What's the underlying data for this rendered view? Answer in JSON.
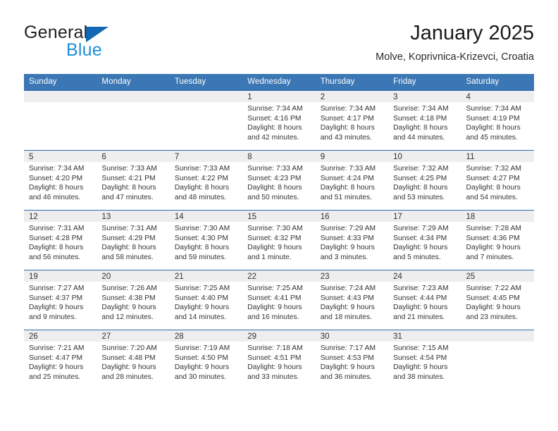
{
  "brand": {
    "name_part1": "General",
    "name_part2": "Blue",
    "triangle_color": "#1268b3",
    "blue_color": "#1d8fd6"
  },
  "header": {
    "title": "January 2025",
    "subtitle": "Molve, Koprivnica-Krizevci, Croatia"
  },
  "theme": {
    "header_bg": "#3b77b5",
    "row_divider": "#2e6cab",
    "daynum_strip_bg": "#eeeeee",
    "text": "#333333"
  },
  "weekdays": [
    "Sunday",
    "Monday",
    "Tuesday",
    "Wednesday",
    "Thursday",
    "Friday",
    "Saturday"
  ],
  "labels": {
    "sunrise_prefix": "Sunrise:",
    "sunset_prefix": "Sunset:",
    "daylight_prefix": "Daylight:"
  },
  "weeks": [
    [
      {
        "day": "",
        "sunrise": "",
        "sunset": "",
        "daylight_line1": "",
        "daylight_line2": ""
      },
      {
        "day": "",
        "sunrise": "",
        "sunset": "",
        "daylight_line1": "",
        "daylight_line2": ""
      },
      {
        "day": "",
        "sunrise": "",
        "sunset": "",
        "daylight_line1": "",
        "daylight_line2": ""
      },
      {
        "day": "1",
        "sunrise": "Sunrise: 7:34 AM",
        "sunset": "Sunset: 4:16 PM",
        "daylight_line1": "Daylight: 8 hours",
        "daylight_line2": "and 42 minutes."
      },
      {
        "day": "2",
        "sunrise": "Sunrise: 7:34 AM",
        "sunset": "Sunset: 4:17 PM",
        "daylight_line1": "Daylight: 8 hours",
        "daylight_line2": "and 43 minutes."
      },
      {
        "day": "3",
        "sunrise": "Sunrise: 7:34 AM",
        "sunset": "Sunset: 4:18 PM",
        "daylight_line1": "Daylight: 8 hours",
        "daylight_line2": "and 44 minutes."
      },
      {
        "day": "4",
        "sunrise": "Sunrise: 7:34 AM",
        "sunset": "Sunset: 4:19 PM",
        "daylight_line1": "Daylight: 8 hours",
        "daylight_line2": "and 45 minutes."
      }
    ],
    [
      {
        "day": "5",
        "sunrise": "Sunrise: 7:34 AM",
        "sunset": "Sunset: 4:20 PM",
        "daylight_line1": "Daylight: 8 hours",
        "daylight_line2": "and 46 minutes."
      },
      {
        "day": "6",
        "sunrise": "Sunrise: 7:33 AM",
        "sunset": "Sunset: 4:21 PM",
        "daylight_line1": "Daylight: 8 hours",
        "daylight_line2": "and 47 minutes."
      },
      {
        "day": "7",
        "sunrise": "Sunrise: 7:33 AM",
        "sunset": "Sunset: 4:22 PM",
        "daylight_line1": "Daylight: 8 hours",
        "daylight_line2": "and 48 minutes."
      },
      {
        "day": "8",
        "sunrise": "Sunrise: 7:33 AM",
        "sunset": "Sunset: 4:23 PM",
        "daylight_line1": "Daylight: 8 hours",
        "daylight_line2": "and 50 minutes."
      },
      {
        "day": "9",
        "sunrise": "Sunrise: 7:33 AM",
        "sunset": "Sunset: 4:24 PM",
        "daylight_line1": "Daylight: 8 hours",
        "daylight_line2": "and 51 minutes."
      },
      {
        "day": "10",
        "sunrise": "Sunrise: 7:32 AM",
        "sunset": "Sunset: 4:25 PM",
        "daylight_line1": "Daylight: 8 hours",
        "daylight_line2": "and 53 minutes."
      },
      {
        "day": "11",
        "sunrise": "Sunrise: 7:32 AM",
        "sunset": "Sunset: 4:27 PM",
        "daylight_line1": "Daylight: 8 hours",
        "daylight_line2": "and 54 minutes."
      }
    ],
    [
      {
        "day": "12",
        "sunrise": "Sunrise: 7:31 AM",
        "sunset": "Sunset: 4:28 PM",
        "daylight_line1": "Daylight: 8 hours",
        "daylight_line2": "and 56 minutes."
      },
      {
        "day": "13",
        "sunrise": "Sunrise: 7:31 AM",
        "sunset": "Sunset: 4:29 PM",
        "daylight_line1": "Daylight: 8 hours",
        "daylight_line2": "and 58 minutes."
      },
      {
        "day": "14",
        "sunrise": "Sunrise: 7:30 AM",
        "sunset": "Sunset: 4:30 PM",
        "daylight_line1": "Daylight: 8 hours",
        "daylight_line2": "and 59 minutes."
      },
      {
        "day": "15",
        "sunrise": "Sunrise: 7:30 AM",
        "sunset": "Sunset: 4:32 PM",
        "daylight_line1": "Daylight: 9 hours",
        "daylight_line2": "and 1 minute."
      },
      {
        "day": "16",
        "sunrise": "Sunrise: 7:29 AM",
        "sunset": "Sunset: 4:33 PM",
        "daylight_line1": "Daylight: 9 hours",
        "daylight_line2": "and 3 minutes."
      },
      {
        "day": "17",
        "sunrise": "Sunrise: 7:29 AM",
        "sunset": "Sunset: 4:34 PM",
        "daylight_line1": "Daylight: 9 hours",
        "daylight_line2": "and 5 minutes."
      },
      {
        "day": "18",
        "sunrise": "Sunrise: 7:28 AM",
        "sunset": "Sunset: 4:36 PM",
        "daylight_line1": "Daylight: 9 hours",
        "daylight_line2": "and 7 minutes."
      }
    ],
    [
      {
        "day": "19",
        "sunrise": "Sunrise: 7:27 AM",
        "sunset": "Sunset: 4:37 PM",
        "daylight_line1": "Daylight: 9 hours",
        "daylight_line2": "and 9 minutes."
      },
      {
        "day": "20",
        "sunrise": "Sunrise: 7:26 AM",
        "sunset": "Sunset: 4:38 PM",
        "daylight_line1": "Daylight: 9 hours",
        "daylight_line2": "and 12 minutes."
      },
      {
        "day": "21",
        "sunrise": "Sunrise: 7:25 AM",
        "sunset": "Sunset: 4:40 PM",
        "daylight_line1": "Daylight: 9 hours",
        "daylight_line2": "and 14 minutes."
      },
      {
        "day": "22",
        "sunrise": "Sunrise: 7:25 AM",
        "sunset": "Sunset: 4:41 PM",
        "daylight_line1": "Daylight: 9 hours",
        "daylight_line2": "and 16 minutes."
      },
      {
        "day": "23",
        "sunrise": "Sunrise: 7:24 AM",
        "sunset": "Sunset: 4:43 PM",
        "daylight_line1": "Daylight: 9 hours",
        "daylight_line2": "and 18 minutes."
      },
      {
        "day": "24",
        "sunrise": "Sunrise: 7:23 AM",
        "sunset": "Sunset: 4:44 PM",
        "daylight_line1": "Daylight: 9 hours",
        "daylight_line2": "and 21 minutes."
      },
      {
        "day": "25",
        "sunrise": "Sunrise: 7:22 AM",
        "sunset": "Sunset: 4:45 PM",
        "daylight_line1": "Daylight: 9 hours",
        "daylight_line2": "and 23 minutes."
      }
    ],
    [
      {
        "day": "26",
        "sunrise": "Sunrise: 7:21 AM",
        "sunset": "Sunset: 4:47 PM",
        "daylight_line1": "Daylight: 9 hours",
        "daylight_line2": "and 25 minutes."
      },
      {
        "day": "27",
        "sunrise": "Sunrise: 7:20 AM",
        "sunset": "Sunset: 4:48 PM",
        "daylight_line1": "Daylight: 9 hours",
        "daylight_line2": "and 28 minutes."
      },
      {
        "day": "28",
        "sunrise": "Sunrise: 7:19 AM",
        "sunset": "Sunset: 4:50 PM",
        "daylight_line1": "Daylight: 9 hours",
        "daylight_line2": "and 30 minutes."
      },
      {
        "day": "29",
        "sunrise": "Sunrise: 7:18 AM",
        "sunset": "Sunset: 4:51 PM",
        "daylight_line1": "Daylight: 9 hours",
        "daylight_line2": "and 33 minutes."
      },
      {
        "day": "30",
        "sunrise": "Sunrise: 7:17 AM",
        "sunset": "Sunset: 4:53 PM",
        "daylight_line1": "Daylight: 9 hours",
        "daylight_line2": "and 36 minutes."
      },
      {
        "day": "31",
        "sunrise": "Sunrise: 7:15 AM",
        "sunset": "Sunset: 4:54 PM",
        "daylight_line1": "Daylight: 9 hours",
        "daylight_line2": "and 38 minutes."
      },
      {
        "day": "",
        "sunrise": "",
        "sunset": "",
        "daylight_line1": "",
        "daylight_line2": ""
      }
    ]
  ]
}
